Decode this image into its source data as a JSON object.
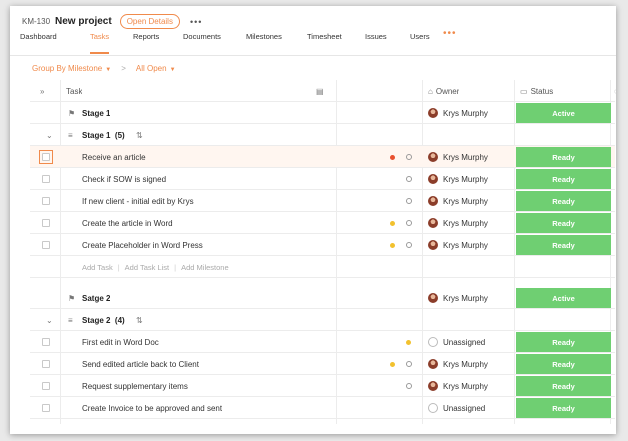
{
  "project": {
    "key": "KM-130",
    "name": "New project",
    "open_details": "Open Details",
    "more": "•••"
  },
  "tabs": [
    {
      "label": "Dashboard",
      "active": false
    },
    {
      "label": "Tasks",
      "active": true
    },
    {
      "label": "Reports",
      "active": false
    },
    {
      "label": "Documents",
      "active": false
    },
    {
      "label": "Milestones",
      "active": false
    },
    {
      "label": "Timesheet",
      "active": false
    },
    {
      "label": "Issues",
      "active": false
    },
    {
      "label": "Users",
      "active": false
    }
  ],
  "tabs_more": "•••",
  "filters": {
    "group_by": "Group By Milestone",
    "separator": ">",
    "scope": "All Open"
  },
  "columns": {
    "task": "Task",
    "owner": "Owner",
    "status": "Status"
  },
  "stage1": {
    "milestone": {
      "name": "Stage 1",
      "owner": "Krys Murphy",
      "status": "Active"
    },
    "list": {
      "name": "Stage 1",
      "count": "(5)"
    },
    "tasks": [
      {
        "name": "Receive an article",
        "owner": "Krys Murphy",
        "status": "Ready",
        "dot": "#e8502f"
      },
      {
        "name": "Check if SOW is signed",
        "owner": "Krys Murphy",
        "status": "Ready",
        "dot": ""
      },
      {
        "name": "If new client - initial edit by Krys",
        "owner": "Krys Murphy",
        "status": "Ready",
        "dot": ""
      },
      {
        "name": "Create the article in Word",
        "owner": "Krys Murphy",
        "status": "Ready",
        "dot": "#f2c12e"
      },
      {
        "name": "Create Placeholder in Word Press",
        "owner": "Krys Murphy",
        "status": "Ready",
        "dot": "#f2c12e"
      }
    ],
    "add": {
      "task": "Add Task",
      "list": "Add Task List",
      "milestone": "Add Milestone"
    }
  },
  "stage2": {
    "milestone": {
      "name": "Satge 2",
      "owner": "Krys Murphy",
      "status": "Active"
    },
    "list": {
      "name": "Stage 2",
      "count": "(4)"
    },
    "tasks": [
      {
        "name": "First edit in Word Doc",
        "owner": "Unassigned",
        "status": "Ready",
        "dot": "#f2c12e",
        "unassigned": true
      },
      {
        "name": "Send edited article back to Client",
        "owner": "Krys Murphy",
        "status": "Ready",
        "dot": "#f2c12e"
      },
      {
        "name": "Request supplementary items",
        "owner": "Krys Murphy",
        "status": "Ready",
        "dot": ""
      },
      {
        "name": "Create Invoice to be approved and sent",
        "owner": "Unassigned",
        "status": "Ready",
        "dot": "",
        "unassigned": true
      }
    ]
  },
  "colors": {
    "accent": "#f08a4b",
    "status_green": "#6fcf72",
    "highlight_row": "#fff6f0"
  }
}
